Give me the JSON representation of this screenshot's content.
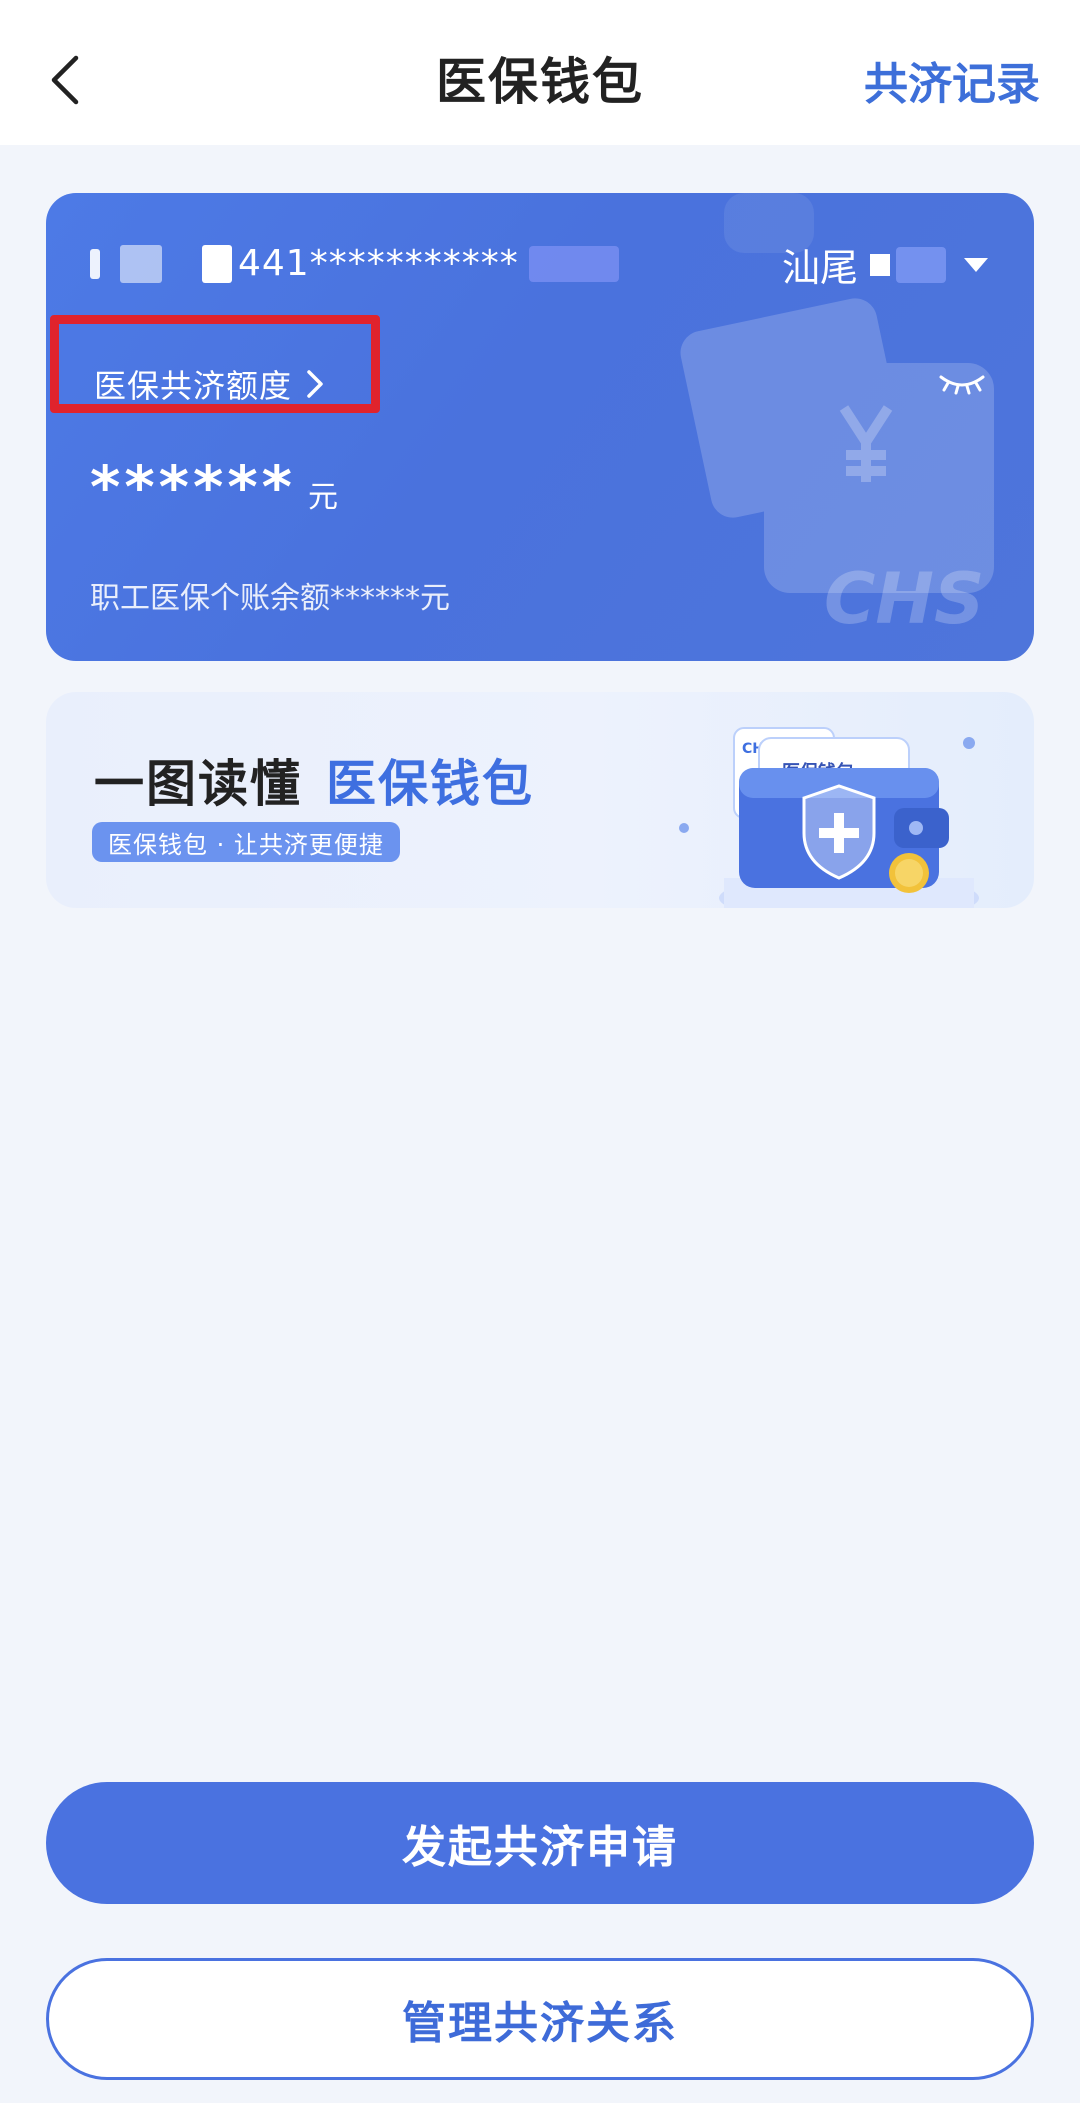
{
  "header": {
    "title": "医保钱包",
    "records_link": "共济记录"
  },
  "card": {
    "id_number": "441***********",
    "city": "汕尾",
    "quota_label": "医保共济额度",
    "amount": "******",
    "amount_unit": "元",
    "balance_text": "职工医保个账余额******元",
    "logo_text": "CHS"
  },
  "banner": {
    "title_part1": "一图读懂",
    "title_part2": "医保钱包",
    "pill_text": "医保钱包 · 让共济更便捷",
    "illus_label": "医保钱包",
    "illus_logo": "CHS"
  },
  "actions": {
    "primary_label": "发起共济申请",
    "secondary_label": "管理共济关系"
  },
  "colors": {
    "brand_blue": "#4a72e0",
    "link_blue": "#3d6fd9",
    "highlight_red": "#e0232c"
  }
}
